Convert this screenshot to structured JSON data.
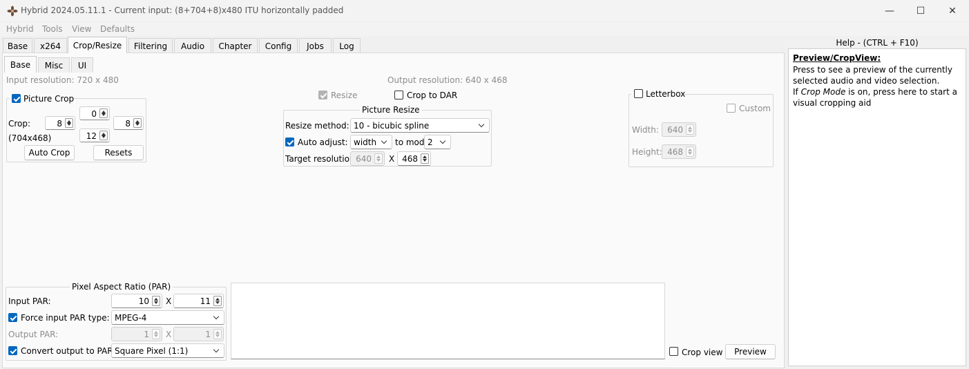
{
  "window": {
    "title": "Hybrid 2024.05.11.1 - Current input: (8+704+8)x480 ITU horizontally padded",
    "minimize": "—",
    "maximize": "☐",
    "close": "✕"
  },
  "menu": [
    "Hybrid",
    "Tools",
    "View",
    "Defaults"
  ],
  "main_tabs": [
    "Base",
    "x264",
    "Crop/Resize",
    "Filtering",
    "Audio",
    "Chapter",
    "Config",
    "Jobs",
    "Log"
  ],
  "sub_tabs": [
    "Base",
    "Misc",
    "UI"
  ],
  "input_resolution": "Input resolution: 720 x 480",
  "output_resolution": "Output resolution: 640 x 468",
  "picture_crop": {
    "label": "Picture Crop",
    "checked": true,
    "crop_label": "Crop:",
    "top": "0",
    "left": "8",
    "right": "8",
    "bottom": "12",
    "size_note": "(704x468)",
    "auto_crop": "Auto Crop",
    "resets": "Resets"
  },
  "resize": {
    "label": "Resize",
    "checked": true
  },
  "crop_to_dar": {
    "label": "Crop to DAR",
    "checked": false
  },
  "picture_resize": {
    "title": "Picture Resize",
    "method_label": "Resize method:",
    "method_value": "10 - bicubic spline",
    "auto_adjust_label": "Auto adjust:",
    "auto_adjust_value": "width",
    "to_mod_label": "to mod",
    "mod_value": "2",
    "target_label": "Target resolution:",
    "target_width": "640",
    "x": "X",
    "target_height": "468"
  },
  "letterbox": {
    "label": "Letterbox",
    "custom_label": "Custom",
    "width_label": "Width:",
    "width_value": "640",
    "height_label": "Height:",
    "height_value": "468"
  },
  "par": {
    "title": "Pixel Aspect Ratio (PAR)",
    "input_label": "Input PAR:",
    "input_num": "10",
    "x": "X",
    "input_den": "11",
    "force_label": "Force input PAR type:",
    "force_value": "MPEG-4",
    "output_label": "Output PAR:",
    "output_num": "1",
    "output_den": "1",
    "convert_label": "Convert output to PAR:",
    "convert_value": "Square Pixel (1:1)"
  },
  "crop_view": "Crop view",
  "preview": "Preview",
  "help": {
    "title": "Help - (CTRL + F10)",
    "heading": "Preview/CropView:",
    "line1": "Press to see a preview of the currently selected audio and video selection.",
    "line2_prefix": "If ",
    "line2_em": "Crop Mode",
    "line2_suffix": " is on, press here to start a visual cropping aid"
  },
  "colors": {
    "accent": "#0067c0",
    "disabled_text": "#8c8c8c"
  }
}
